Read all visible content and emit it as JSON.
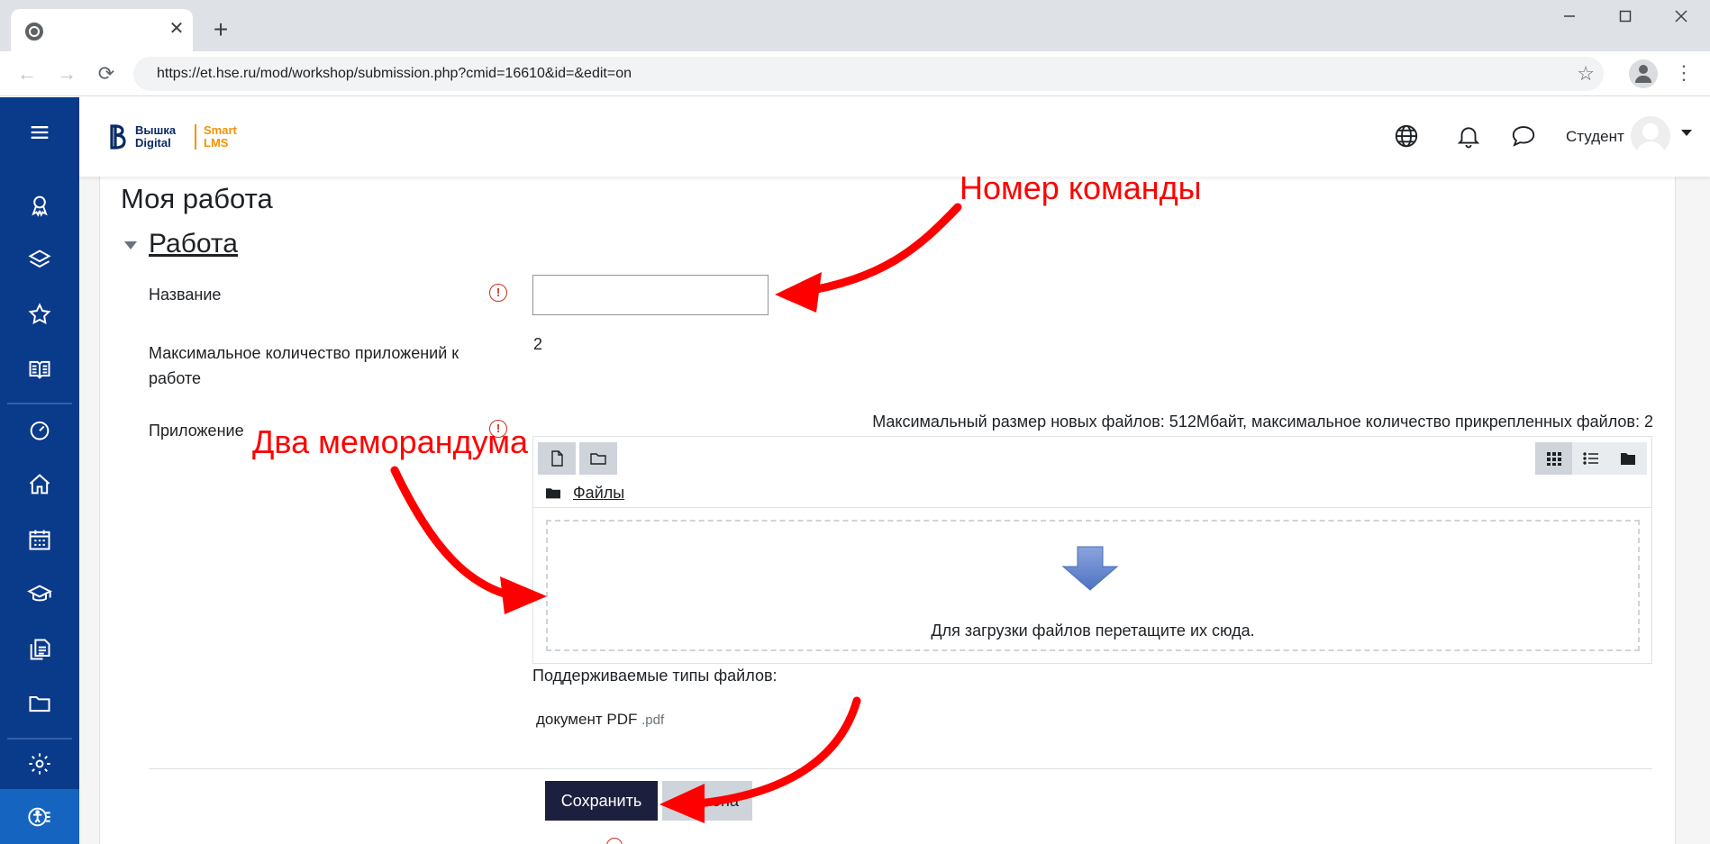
{
  "browser": {
    "tab_close_glyph": "✕",
    "new_tab_glyph": "+",
    "url": "https://et.hse.ru/mod/workshop/submission.php?cmid=16610&id=&edit=on"
  },
  "header": {
    "logo_line1": "Вышка",
    "logo_line2": "Digital",
    "logo_brand1": "Smart",
    "logo_brand2": "LMS",
    "user_name": "Студент"
  },
  "page": {
    "title": "Моя работа",
    "section_title": "Работа"
  },
  "form": {
    "title_label": "Название",
    "title_value": "",
    "max_attach_label_line1": "Максимальное количество приложений к",
    "max_attach_label_line2": "работе",
    "max_attach_value": "2",
    "attachment_label": "Приложение",
    "max_info": "Максимальный размер новых файлов: 512Мбайт, максимальное количество прикрепленных файлов: 2",
    "files_folder_label": "Файлы",
    "drop_text": "Для загрузки файлов перетащите их сюда.",
    "supported_types_label": "Поддерживаемые типы файлов:",
    "supported_type_name": "документ PDF",
    "supported_type_ext": ".pdf",
    "save_label": "Сохранить",
    "cancel_label": "ена"
  },
  "annotations": {
    "team_number": "Номер команды",
    "two_memos": "Два меморандума"
  },
  "colors": {
    "nav_bg": "#0a3a8a",
    "save_btn_bg": "#1d1f3f",
    "annotation": "#ff0000",
    "required": "#ca3120",
    "brand_orange": "#f39200"
  }
}
